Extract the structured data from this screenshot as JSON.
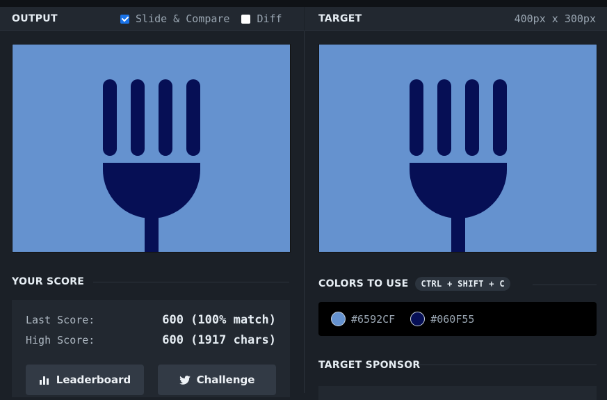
{
  "output_panel": {
    "title": "OUTPUT",
    "slide_compare_label": "Slide & Compare",
    "slide_compare_checked": true,
    "diff_label": "Diff",
    "diff_checked": false
  },
  "target_panel": {
    "title": "TARGET",
    "dimensions": "400px x 300px"
  },
  "score": {
    "title": "YOUR SCORE",
    "last_label": "Last Score:",
    "last_value": "600 (100% match)",
    "high_label": "High Score:",
    "high_value": "600 (1917 chars)",
    "leaderboard_label": "Leaderboard",
    "challenge_label": "Challenge"
  },
  "colors": {
    "title": "COLORS TO USE",
    "shortcut": "CTRL + SHIFT + C",
    "items": [
      {
        "hex": "#6592CF",
        "label": "#6592CF"
      },
      {
        "hex": "#060F55",
        "label": "#060F55"
      }
    ]
  },
  "sponsor": {
    "title": "TARGET SPONSOR"
  },
  "icons": {
    "leaderboard": "bar-chart-icon",
    "challenge": "twitter-icon"
  }
}
